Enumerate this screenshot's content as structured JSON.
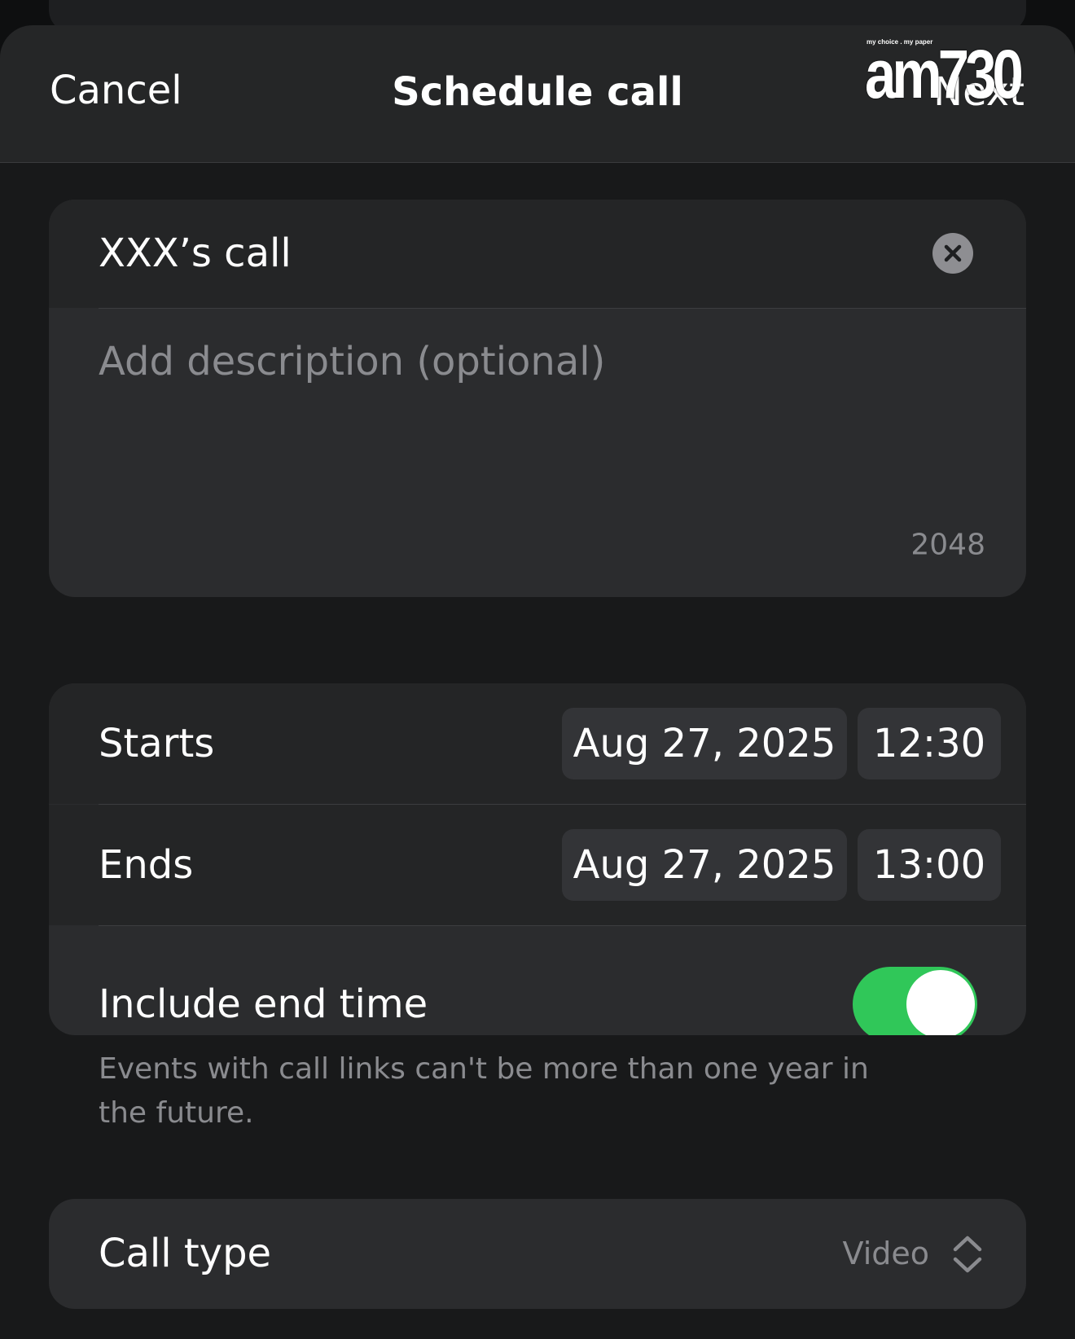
{
  "nav": {
    "cancel_label": "Cancel",
    "title": "Schedule call",
    "next_label": "Next"
  },
  "watermark": {
    "tagline": "my choice . my paper",
    "brand": "am730"
  },
  "event": {
    "title_value": "XXX’s call",
    "description_placeholder": "Add description (optional)",
    "char_remaining": "2048"
  },
  "schedule": {
    "starts_label": "Starts",
    "starts_date": "Aug 27, 2025",
    "starts_time": "12:30",
    "ends_label": "Ends",
    "ends_date": "Aug 27, 2025",
    "ends_time": "13:00",
    "include_end_label": "Include end time",
    "include_end_on": true,
    "footnote": "Events with call links can't be more than one year in the future."
  },
  "call_type": {
    "label": "Call type",
    "value": "Video"
  },
  "colors": {
    "toggle_on": "#30c759",
    "sheet_bg": "#18191a",
    "card_bg": "#2b2c2e"
  }
}
